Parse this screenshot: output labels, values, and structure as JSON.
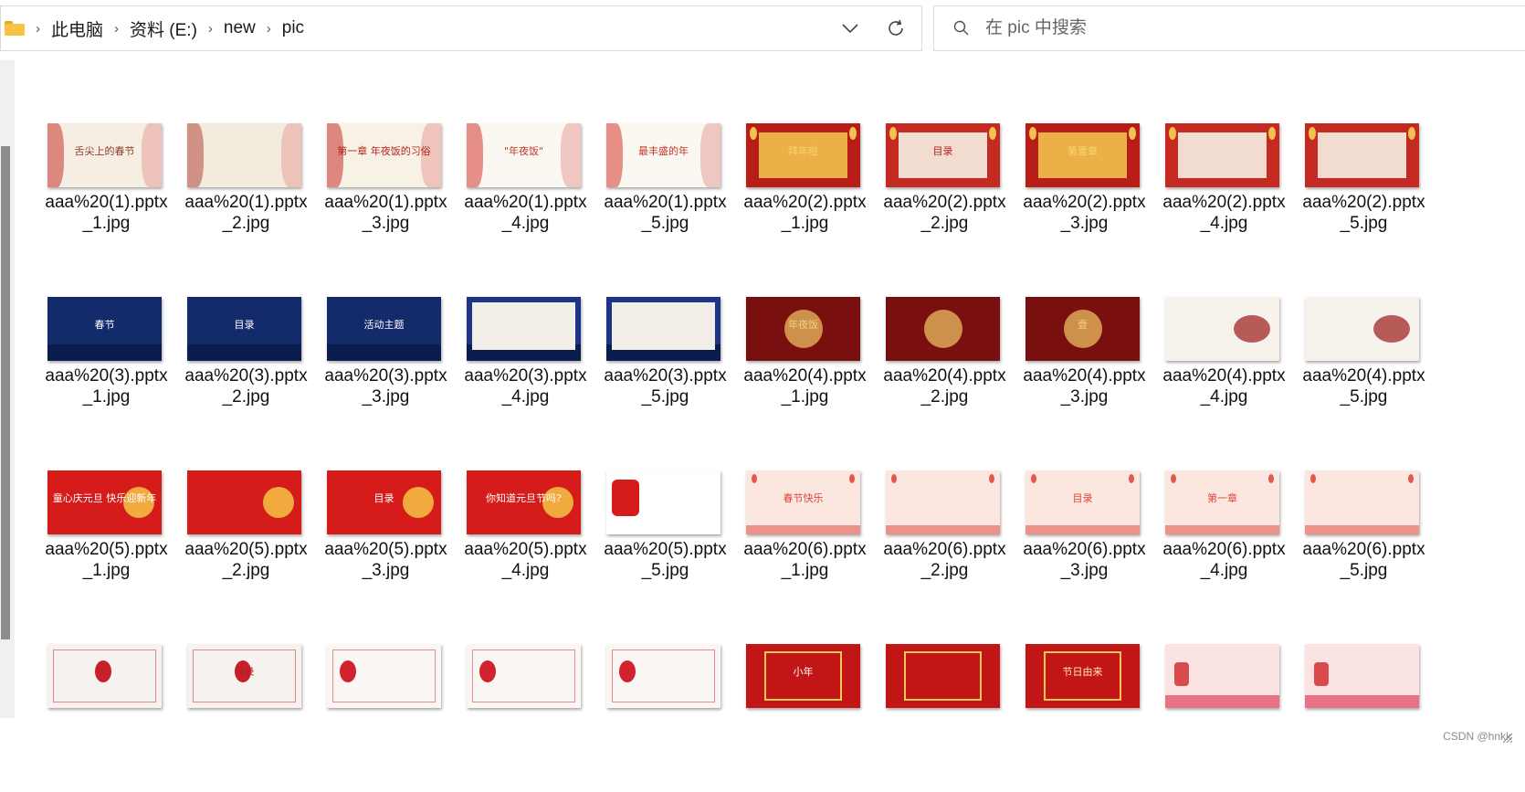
{
  "address": {
    "path": [
      "此电脑",
      "资料 (E:)",
      "new",
      "pic"
    ]
  },
  "search": {
    "placeholder": "在 pic 中搜索"
  },
  "watermark": "CSDN @hnkk",
  "files": [
    {
      "name": "aaa%20(1).pptx_1.jpg",
      "line1": "aaa%20(1).pptx",
      "line2": "_1.jpg",
      "style": "a1",
      "text": "舌尖上的春节"
    },
    {
      "name": "aaa%20(1).pptx_2.jpg",
      "line1": "aaa%20(1).pptx",
      "line2": "_2.jpg",
      "style": "a2",
      "text": ""
    },
    {
      "name": "aaa%20(1).pptx_3.jpg",
      "line1": "aaa%20(1).pptx",
      "line2": "_3.jpg",
      "style": "a3",
      "text": "第一章 年夜饭的习俗"
    },
    {
      "name": "aaa%20(1).pptx_4.jpg",
      "line1": "aaa%20(1).pptx",
      "line2": "_4.jpg",
      "style": "a4",
      "text": "\"年夜饭\""
    },
    {
      "name": "aaa%20(1).pptx_5.jpg",
      "line1": "aaa%20(1).pptx",
      "line2": "_5.jpg",
      "style": "a4",
      "text": "最丰盛的年"
    },
    {
      "name": "aaa%20(2).pptx_1.jpg",
      "line1": "aaa%20(2).pptx",
      "line2": "_1.jpg",
      "style": "b1",
      "text": "拜年啦"
    },
    {
      "name": "aaa%20(2).pptx_2.jpg",
      "line1": "aaa%20(2).pptx",
      "line2": "_2.jpg",
      "style": "b2",
      "text": "目录"
    },
    {
      "name": "aaa%20(2).pptx_3.jpg",
      "line1": "aaa%20(2).pptx",
      "line2": "_3.jpg",
      "style": "b1",
      "text": "第壹章"
    },
    {
      "name": "aaa%20(2).pptx_4.jpg",
      "line1": "aaa%20(2).pptx",
      "line2": "_4.jpg",
      "style": "b3",
      "text": ""
    },
    {
      "name": "aaa%20(2).pptx_5.jpg",
      "line1": "aaa%20(2).pptx",
      "line2": "_5.jpg",
      "style": "b3",
      "text": ""
    },
    {
      "name": "aaa%20(3).pptx_1.jpg",
      "line1": "aaa%20(3).pptx",
      "line2": "_1.jpg",
      "style": "c1",
      "text": "春节"
    },
    {
      "name": "aaa%20(3).pptx_2.jpg",
      "line1": "aaa%20(3).pptx",
      "line2": "_2.jpg",
      "style": "c1",
      "text": "目录"
    },
    {
      "name": "aaa%20(3).pptx_3.jpg",
      "line1": "aaa%20(3).pptx",
      "line2": "_3.jpg",
      "style": "c1",
      "text": "活动主题"
    },
    {
      "name": "aaa%20(3).pptx_4.jpg",
      "line1": "aaa%20(3).pptx",
      "line2": "_4.jpg",
      "style": "c2",
      "text": ""
    },
    {
      "name": "aaa%20(3).pptx_5.jpg",
      "line1": "aaa%20(3).pptx",
      "line2": "_5.jpg",
      "style": "c2",
      "text": ""
    },
    {
      "name": "aaa%20(4).pptx_1.jpg",
      "line1": "aaa%20(4).pptx",
      "line2": "_1.jpg",
      "style": "d1",
      "text": "年夜饭"
    },
    {
      "name": "aaa%20(4).pptx_2.jpg",
      "line1": "aaa%20(4).pptx",
      "line2": "_2.jpg",
      "style": "d1",
      "text": ""
    },
    {
      "name": "aaa%20(4).pptx_3.jpg",
      "line1": "aaa%20(4).pptx",
      "line2": "_3.jpg",
      "style": "d1",
      "text": "壹"
    },
    {
      "name": "aaa%20(4).pptx_4.jpg",
      "line1": "aaa%20(4).pptx",
      "line2": "_4.jpg",
      "style": "d2",
      "text": ""
    },
    {
      "name": "aaa%20(4).pptx_5.jpg",
      "line1": "aaa%20(4).pptx",
      "line2": "_5.jpg",
      "style": "d2",
      "text": ""
    },
    {
      "name": "aaa%20(5).pptx_1.jpg",
      "line1": "aaa%20(5).pptx",
      "line2": "_1.jpg",
      "style": "e1",
      "text": "童心庆元旦 快乐迎新年"
    },
    {
      "name": "aaa%20(5).pptx_2.jpg",
      "line1": "aaa%20(5).pptx",
      "line2": "_2.jpg",
      "style": "e1",
      "text": ""
    },
    {
      "name": "aaa%20(5).pptx_3.jpg",
      "line1": "aaa%20(5).pptx",
      "line2": "_3.jpg",
      "style": "e1",
      "text": "目录"
    },
    {
      "name": "aaa%20(5).pptx_4.jpg",
      "line1": "aaa%20(5).pptx",
      "line2": "_4.jpg",
      "style": "e1",
      "text": "你知道元旦节吗?"
    },
    {
      "name": "aaa%20(5).pptx_5.jpg",
      "line1": "aaa%20(5).pptx",
      "line2": "_5.jpg",
      "style": "e2",
      "text": ""
    },
    {
      "name": "aaa%20(6).pptx_1.jpg",
      "line1": "aaa%20(6).pptx",
      "line2": "_1.jpg",
      "style": "f1",
      "text": "春节快乐"
    },
    {
      "name": "aaa%20(6).pptx_2.jpg",
      "line1": "aaa%20(6).pptx",
      "line2": "_2.jpg",
      "style": "f1",
      "text": ""
    },
    {
      "name": "aaa%20(6).pptx_3.jpg",
      "line1": "aaa%20(6).pptx",
      "line2": "_3.jpg",
      "style": "f1",
      "text": "目录"
    },
    {
      "name": "aaa%20(6).pptx_4.jpg",
      "line1": "aaa%20(6).pptx",
      "line2": "_4.jpg",
      "style": "f1",
      "text": "第一章"
    },
    {
      "name": "aaa%20(6).pptx_5.jpg",
      "line1": "aaa%20(6).pptx",
      "line2": "_5.jpg",
      "style": "f1",
      "text": ""
    },
    {
      "name": "row4_1",
      "line1": "",
      "line2": "",
      "style": "g1",
      "text": ""
    },
    {
      "name": "row4_2",
      "line1": "",
      "line2": "",
      "style": "g1",
      "text": "目录"
    },
    {
      "name": "row4_3",
      "line1": "",
      "line2": "",
      "style": "g2",
      "text": ""
    },
    {
      "name": "row4_4",
      "line1": "",
      "line2": "",
      "style": "g2",
      "text": ""
    },
    {
      "name": "row4_5",
      "line1": "",
      "line2": "",
      "style": "g2",
      "text": ""
    },
    {
      "name": "row4_6",
      "line1": "",
      "line2": "",
      "style": "h1",
      "text": "小年"
    },
    {
      "name": "row4_7",
      "line1": "",
      "line2": "",
      "style": "h2",
      "text": ""
    },
    {
      "name": "row4_8",
      "line1": "",
      "line2": "",
      "style": "h2",
      "text": "节日由来"
    },
    {
      "name": "row4_9",
      "line1": "",
      "line2": "",
      "style": "i1",
      "text": ""
    },
    {
      "name": "row4_10",
      "line1": "",
      "line2": "",
      "style": "i1",
      "text": ""
    }
  ],
  "thumb_styles": {
    "a1": {
      "bg": "#f6eee2",
      "accent": "#c8342b",
      "text": "#8a3b2a"
    },
    "a2": {
      "bg": "#f4ebdf",
      "accent": "#b5483a",
      "text": "#6a4a3a"
    },
    "a3": {
      "bg": "#f8f1e6",
      "accent": "#c62f28",
      "text": "#b0281f"
    },
    "a4": {
      "bg": "#fbf7f1",
      "accent": "#d33a30",
      "text": "#c0392b"
    },
    "b1": {
      "bg": "#b81d17",
      "accent": "#f2c14e",
      "text": "#f7d774"
    },
    "b2": {
      "bg": "#c42a22",
      "accent": "#f7efe2",
      "text": "#b5201a"
    },
    "b3": {
      "bg": "#c42a22",
      "accent": "#f7efe2",
      "text": "#b5201a"
    },
    "c1": {
      "bg": "#132a6b",
      "accent": "#ffffff",
      "text": "#ffffff"
    },
    "c2": {
      "bg": "#1d3489",
      "accent": "#f3efe8",
      "text": "#233a8c"
    },
    "d1": {
      "bg": "#7a0f0f",
      "accent": "#e3b15a",
      "text": "#f3d27a"
    },
    "d2": {
      "bg": "#f7f2ec",
      "accent": "#9b1b1b",
      "text": "#7a1b1b"
    },
    "e1": {
      "bg": "#d61b1b",
      "accent": "#ffffff",
      "text": "#ffffff"
    },
    "e2": {
      "bg": "#ffffff",
      "accent": "#d61b1b",
      "text": "#c11b1b"
    },
    "f1": {
      "bg": "#fbe6e0",
      "accent": "#e35a4c",
      "text": "#d9483a"
    },
    "g1": {
      "bg": "#f5f2ef",
      "accent": "#c8202a",
      "text": "#b31f26"
    },
    "g2": {
      "bg": "#faf6f4",
      "accent": "#d2222f",
      "text": "#b31f26"
    },
    "h1": {
      "bg": "#c21616",
      "accent": "#f3c65a",
      "text": "#ffffff"
    },
    "h2": {
      "bg": "#c21616",
      "accent": "#f3c65a",
      "text": "#ffe9a8"
    },
    "i1": {
      "bg": "#fbe3e3",
      "accent": "#e0405a",
      "text": "#c32b48"
    }
  }
}
